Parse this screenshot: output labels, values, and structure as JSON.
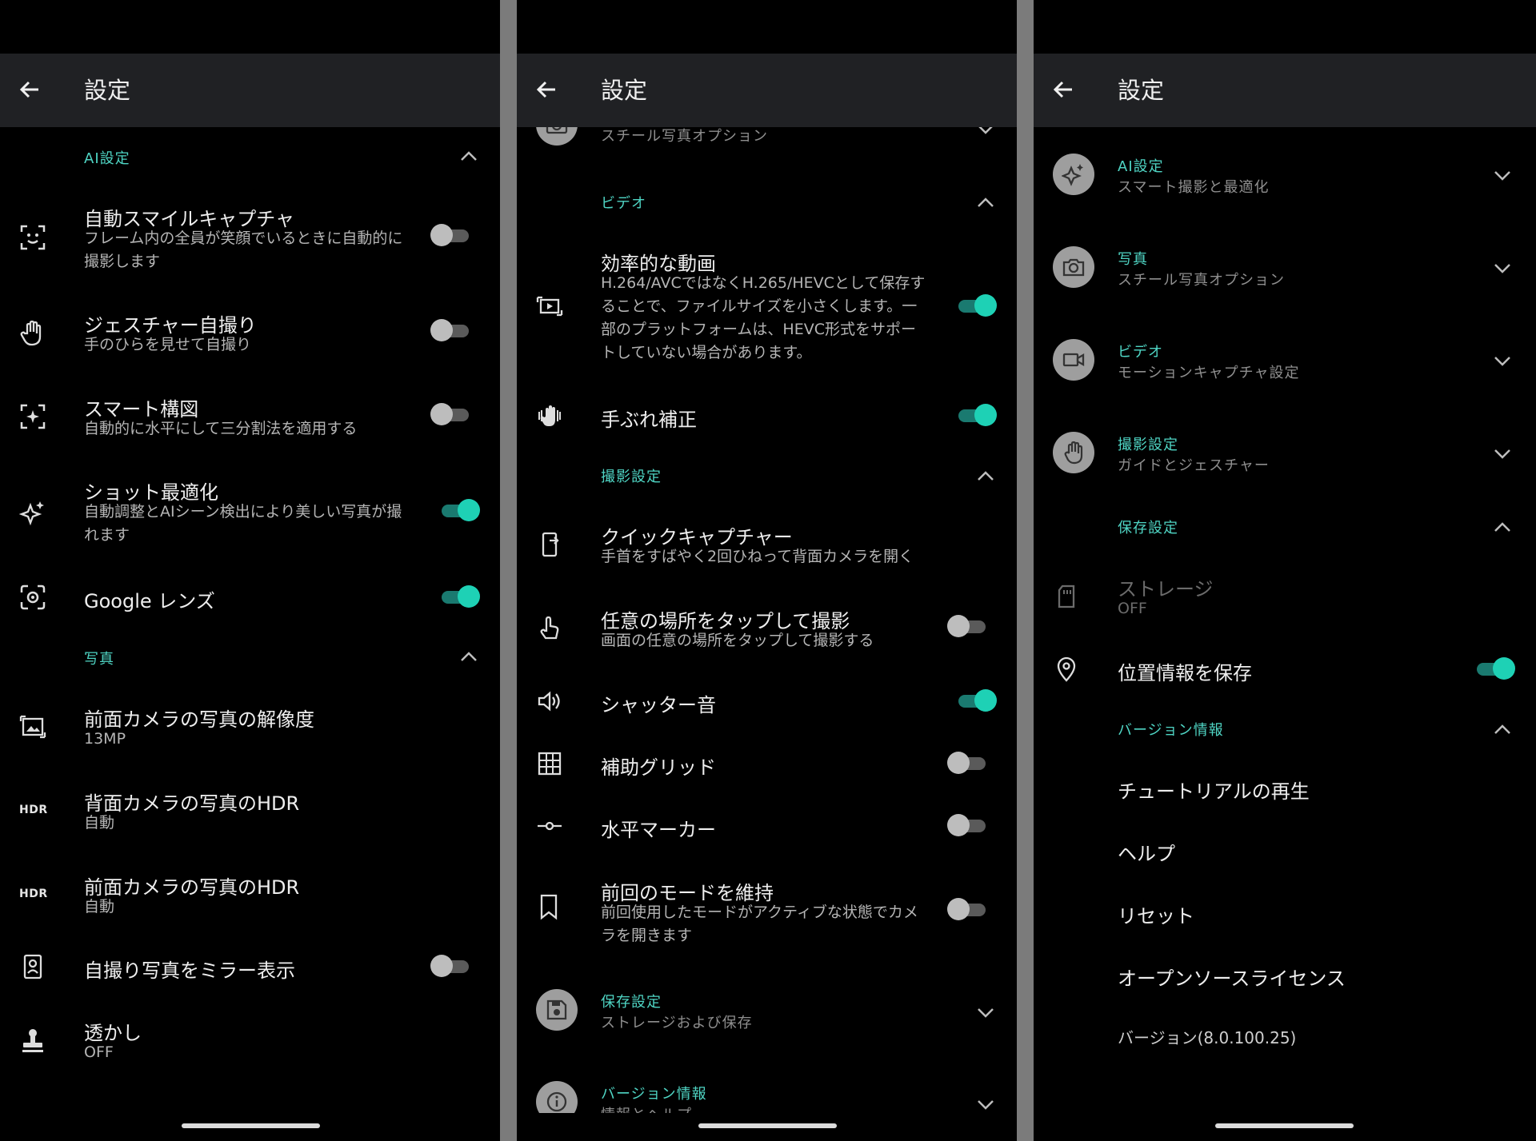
{
  "panel1": {
    "title": "設定",
    "ai_section": "AI設定",
    "items": [
      {
        "title": "自動スマイルキャプチャ",
        "sub": "フレーム内の全員が笑顔でいるときに自動的に撮影します"
      },
      {
        "title": "ジェスチャー自撮り",
        "sub": "手のひらを見せて自撮り"
      },
      {
        "title": "スマート構図",
        "sub": "自動的に水平にして三分割法を適用する"
      },
      {
        "title": "ショット最適化",
        "sub": "自動調整とAIシーン検出により美しい写真が撮れます"
      },
      {
        "title": "Google レンズ"
      }
    ],
    "photo_section": "写真",
    "photo_items": [
      {
        "title": "前面カメラの写真の解像度",
        "sub": "13MP"
      },
      {
        "title": "背面カメラの写真のHDR",
        "sub": "自動",
        "icon_text": "HDR"
      },
      {
        "title": "前面カメラの写真のHDR",
        "sub": "自動",
        "icon_text": "HDR"
      },
      {
        "title": "自撮り写真をミラー表示"
      },
      {
        "title": "透かし",
        "sub": "OFF"
      }
    ],
    "toggles": {
      "smile": false,
      "gesture": false,
      "composition": false,
      "optimize": true,
      "lens": true,
      "mirror": false
    }
  },
  "panel2": {
    "title": "設定",
    "top_partial_sub": "スチール写真オプション",
    "video_section": "ビデオ",
    "efficient_title": "効率的な動画",
    "efficient_sub": "H.264/AVCではなくH.265/HEVCとして保存することで、ファイルサイズを小さくします。一部のプラットフォームは、HEVC形式をサポートしていない場合があります。",
    "stabilize_title": "手ぶれ補正",
    "shoot_section": "撮影設定",
    "items": [
      {
        "title": "クイックキャプチャー",
        "sub": "手首をすばやく2回ひねって背面カメラを開く"
      },
      {
        "title": "任意の場所をタップして撮影",
        "sub": "画面の任意の場所をタップして撮影する"
      },
      {
        "title": "シャッター音"
      },
      {
        "title": "補助グリッド"
      },
      {
        "title": "水平マーカー"
      },
      {
        "title": "前回のモードを維持",
        "sub": "前回使用したモードがアクティブな状態でカメラを開きます"
      }
    ],
    "save_title": "保存設定",
    "save_sub": "ストレージおよび保存",
    "version_title": "バージョン情報",
    "version_partial": "情報とヘルプ",
    "toggles": {
      "efficient": true,
      "stabilize": true,
      "tap": false,
      "shutter": true,
      "grid": false,
      "level": false,
      "keep_mode": false
    }
  },
  "panel3": {
    "title": "設定",
    "cats": [
      {
        "title": "AI設定",
        "sub": "スマート撮影と最適化"
      },
      {
        "title": "写真",
        "sub": "スチール写真オプション"
      },
      {
        "title": "ビデオ",
        "sub": "モーションキャプチャ設定"
      },
      {
        "title": "撮影設定",
        "sub": "ガイドとジェスチャー"
      }
    ],
    "save_section": "保存設定",
    "storage_title": "ストレージ",
    "storage_sub": "OFF",
    "location_title": "位置情報を保存",
    "version_section": "バージョン情報",
    "links": [
      "チュートリアルの再生",
      "ヘルプ",
      "リセット",
      "オープンソースライセンス",
      "バージョン(8.0.100.25)"
    ],
    "toggles": {
      "location": true
    }
  },
  "colors": {
    "accent": "#1ed1b5",
    "accent_text": "#4fd5c4",
    "appbar": "#202124",
    "divider": "#7b7b7b"
  }
}
